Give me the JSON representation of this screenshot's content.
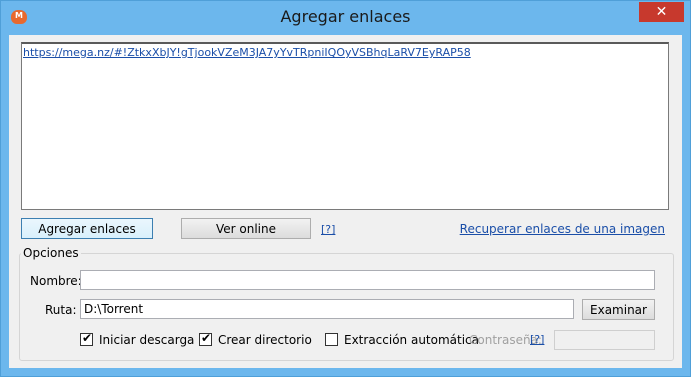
{
  "window": {
    "title": "Agregar enlaces",
    "close_symbol": "✕",
    "app_icon_letter": "M"
  },
  "links": {
    "text": "https://mega.nz/#!ZtkxXbJY!gTjookVZeM3JA7yYvTRpniIQOyVSBhqLaRV7EyRAP58"
  },
  "buttons": {
    "add_links": "Agregar enlaces",
    "view_online": "Ver online",
    "help": "[?]",
    "recover_links": "Recuperar enlaces de una imagen"
  },
  "options": {
    "group_title": "Opciones",
    "name_label": "Nombre:",
    "name_value": "",
    "path_label": "Ruta:",
    "path_value": "D:\\Torrent",
    "browse_button": "Examinar",
    "start_download": {
      "label": "Iniciar descarga",
      "checked": true
    },
    "create_dir": {
      "label": "Crear directorio",
      "checked": true
    },
    "auto_extract": {
      "label": "Extracción automática",
      "checked": false
    },
    "password_label": "Contraseña:",
    "password_help": "[?]",
    "password_value": ""
  }
}
